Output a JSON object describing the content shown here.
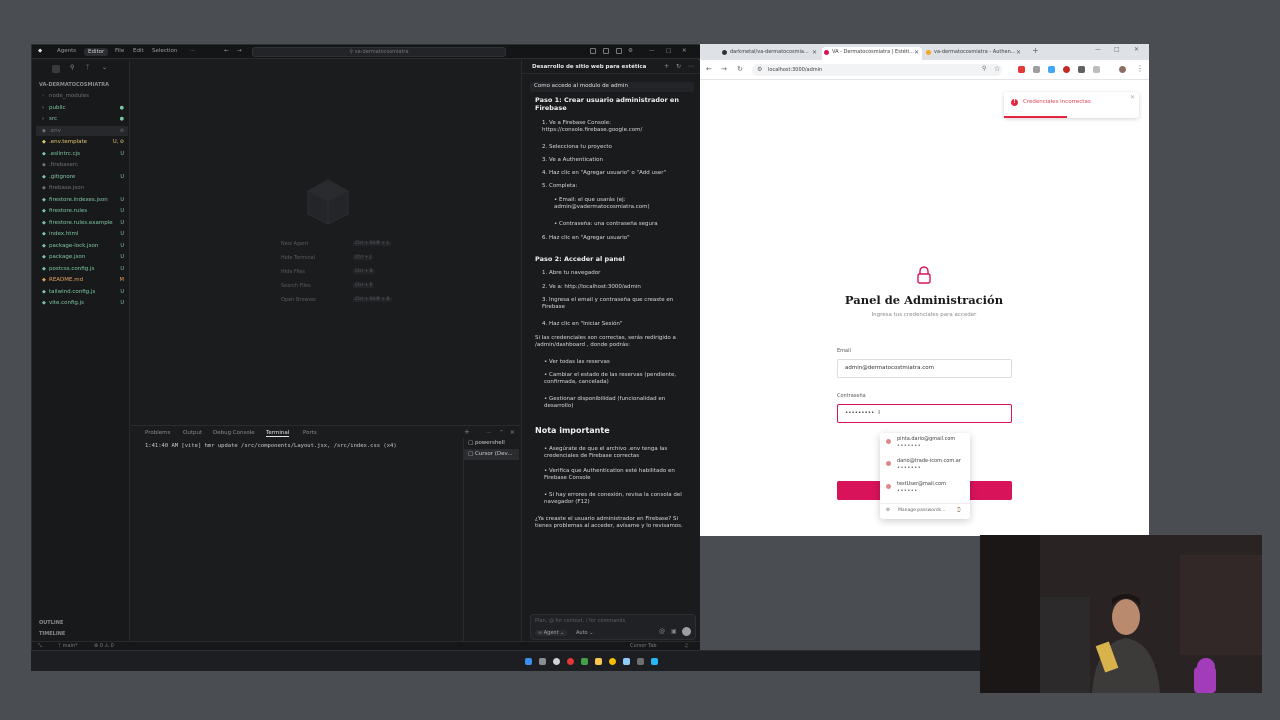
{
  "editor": {
    "title_tabs": [
      "Agents",
      "Editor"
    ],
    "menu": [
      "File",
      "Edit",
      "Selection"
    ],
    "search_text": "va-dermatocosmiatra",
    "sidebar": {
      "root": "VA-DERMATOCOSMIATRA",
      "items": [
        {
          "label": "node_modules",
          "badge": "",
          "color": "#6f7276"
        },
        {
          "label": "public",
          "badge": "●",
          "color": "#7dc7a3"
        },
        {
          "label": "src",
          "badge": "●",
          "color": "#7dc7a3"
        },
        {
          "label": ".env",
          "badge": "⊘",
          "color": "#6f7276"
        },
        {
          "label": ".env.template",
          "badge": "U, ⊘",
          "color": "#e6c86e"
        },
        {
          "label": ".eslintrc.cjs",
          "badge": "U",
          "color": "#7dc7a3"
        },
        {
          "label": ".firebaserc",
          "badge": "",
          "color": "#6f7276"
        },
        {
          "label": ".gitignore",
          "badge": "U",
          "color": "#7dc7a3"
        },
        {
          "label": "firebase.json",
          "badge": "",
          "color": "#6f7276"
        },
        {
          "label": "firestore.indexes.json",
          "badge": "U",
          "color": "#7dc7a3"
        },
        {
          "label": "firestore.rules",
          "badge": "U",
          "color": "#7dc7a3"
        },
        {
          "label": "firestore.rules.example",
          "badge": "U",
          "color": "#7dc7a3"
        },
        {
          "label": "index.html",
          "badge": "U",
          "color": "#7dc7a3"
        },
        {
          "label": "package-lock.json",
          "badge": "U",
          "color": "#7dc7a3"
        },
        {
          "label": "package.json",
          "badge": "U",
          "color": "#7dc7a3"
        },
        {
          "label": "postcss.config.js",
          "badge": "U",
          "color": "#7dc7a3"
        },
        {
          "label": "README.md",
          "badge": "M",
          "color": "#e6a35a"
        },
        {
          "label": "tailwind.config.js",
          "badge": "U",
          "color": "#7dc7a3"
        },
        {
          "label": "vite.config.js",
          "badge": "U",
          "color": "#7dc7a3"
        }
      ],
      "outline": "OUTLINE",
      "timeline": "TIMELINE"
    },
    "shortcuts": [
      {
        "label": "New Agent",
        "keys": "Ctrl + Shift + L"
      },
      {
        "label": "Hide Terminal",
        "keys": "Ctrl + J"
      },
      {
        "label": "Hide Files",
        "keys": "Ctrl + B"
      },
      {
        "label": "Search Files",
        "keys": "Ctrl + P"
      },
      {
        "label": "Open Browser",
        "keys": "Ctrl + Shift + B"
      }
    ],
    "panel_tabs": [
      "Problems",
      "Output",
      "Debug Console",
      "Terminal",
      "Ports"
    ],
    "terminal_line": "1:41:40 AM [vite] hmr update /src/components/Layout.jsx, /src/index.css (x4)",
    "terminal_list": [
      "powershell",
      "Cursor (Dev..."
    ],
    "status": {
      "branch": "main*",
      "problems": "⊗ 0 ⚠ 0",
      "cursor_tab": "Cursor Tab"
    }
  },
  "chat": {
    "header": "Desarrollo de sitio web para estética",
    "question": "Como accedo al modulo de admin",
    "step1_title": "Paso 1: Crear usuario administrador en Firebase",
    "step1": [
      "1. Ve a Firebase Console: https://console.firebase.google.com/",
      "2. Selecciona tu proyecto",
      "3. Ve a Authentication",
      "4. Haz clic en \"Agregar usuario\" o \"Add user\"",
      "5. Completa:"
    ],
    "step1_bullets": [
      "Email: el que usarás (ej: admin@vadermatocosmiatra.com)",
      "Contraseña: una contraseña segura"
    ],
    "step1_last": "6. Haz clic en \"Agregar usuario\"",
    "step2_title": "Paso 2: Acceder al panel",
    "step2": [
      "1. Abre tu navegador",
      "2. Ve a: http://localhost:3000/admin",
      "3. Ingresa el email y contraseña que creaste en Firebase",
      "4. Haz clic en \"Iniciar Sesión\""
    ],
    "redirect_text": "Si las credenciales son correctas, serás redirigido a /admin/dashboard , donde podrás:",
    "redirect_bullets": [
      "Ver todas las reservas",
      "Cambiar el estado de las reservas (pendiente, confirmada, cancelada)",
      "Gestionar disponibilidad (funcionalidad en desarrollo)"
    ],
    "note_title": "Nota importante",
    "note_bullets": [
      "Asegúrate de que el archivo .env tenga las credenciales de Firebase correctas",
      "Verifica que Authentication esté habilitado en Firebase Console",
      "Si hay errores de conexión, revisa la consola del navegador (F12)"
    ],
    "closing": "¿Ya creaste el usuario administrador en Firebase? Si tienes problemas al acceder, avísame y lo revisamos.",
    "input_placeholder": "Plan, @ for context, / for commands",
    "mode": "Agent",
    "model": "Auto"
  },
  "browser": {
    "tabs": [
      "darkmetal/va-dermatocosmia...",
      "VA - Dermatocosmiatra | Estéti...",
      "va-dermatocosmiatra - Authen..."
    ],
    "url": "localhost:3000/admin",
    "toast": "Credenciales incorrectas",
    "toast_progress": 0.47,
    "login": {
      "title": "Panel de Administración",
      "subtitle": "Ingresa tus credenciales para acceder",
      "email_label": "Email",
      "email_value": "admin@dermatocostmiatra.com",
      "password_label": "Contraseña",
      "password_value": "•••••••••"
    },
    "autofill": [
      {
        "email": "pinta.dario@gmail.com",
        "password": "•••••••"
      },
      {
        "email": "dario@trade-icom.com.ar",
        "password": "•••••••"
      },
      {
        "email": "testUser@mail.com",
        "password": "••••••"
      }
    ],
    "autofill_manage": "Manage passwords..."
  },
  "colors": {
    "accent": "#d8135a",
    "error": "#e5253f",
    "editor_bg": "#1b1c1e"
  }
}
